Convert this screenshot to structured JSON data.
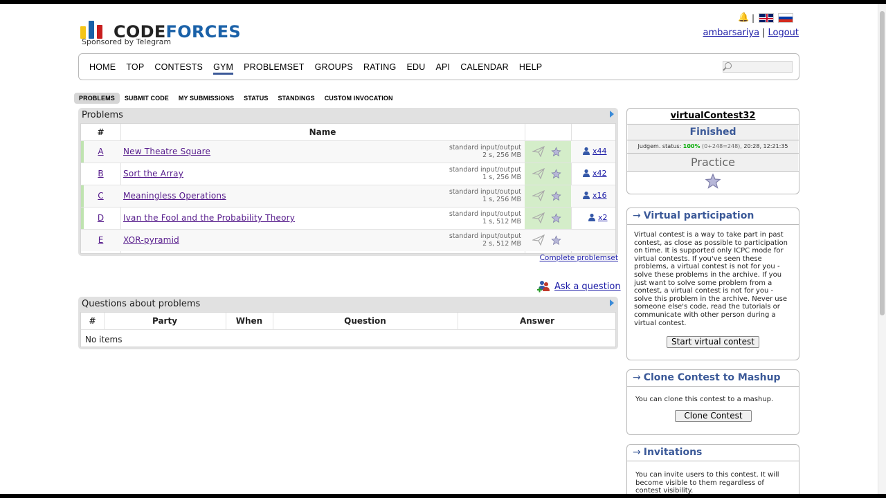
{
  "header": {
    "logo_main_1": "CODE",
    "logo_main_2": "FORCES",
    "logo_sub": "Sponsored by Telegram",
    "username": "ambarsariya",
    "logout": "Logout",
    "lang_sep": "|",
    "user_sep": "|"
  },
  "menu": {
    "items": [
      "HOME",
      "TOP",
      "CONTESTS",
      "GYM",
      "PROBLEMSET",
      "GROUPS",
      "RATING",
      "EDU",
      "API",
      "CALENDAR",
      "HELP"
    ],
    "active": "GYM"
  },
  "submenu": {
    "items": [
      "PROBLEMS",
      "SUBMIT CODE",
      "MY SUBMISSIONS",
      "STATUS",
      "STANDINGS",
      "CUSTOM INVOCATION"
    ],
    "active": "PROBLEMS"
  },
  "problems": {
    "caption": "Problems",
    "col_index": "#",
    "col_name": "Name",
    "rows": [
      {
        "index": "A",
        "name": "New Theatre Square",
        "io": "standard input/output",
        "limits": "2 s, 256 MB",
        "solved": true,
        "count": "x44"
      },
      {
        "index": "B",
        "name": "Sort the Array",
        "io": "standard input/output",
        "limits": "1 s, 256 MB",
        "solved": true,
        "count": "x42"
      },
      {
        "index": "C",
        "name": "Meaningless Operations",
        "io": "standard input/output",
        "limits": "1 s, 256 MB",
        "solved": true,
        "count": "x16"
      },
      {
        "index": "D",
        "name": "Ivan the Fool and the Probability Theory",
        "io": "standard input/output",
        "limits": "1 s, 512 MB",
        "solved": true,
        "count": "x2"
      },
      {
        "index": "E",
        "name": "XOR-pyramid",
        "io": "standard input/output",
        "limits": "2 s, 512 MB",
        "solved": false,
        "count": ""
      }
    ],
    "complete_link": "Complete problemset"
  },
  "ask_question": "Ask a question",
  "questions": {
    "caption": "Questions about problems",
    "columns": [
      "#",
      "Party",
      "When",
      "Question",
      "Answer"
    ],
    "empty": "No items"
  },
  "contest": {
    "name": "virtualContest32",
    "status": "Finished",
    "judge_prefix": "Judgem. status:",
    "judge_pct": "100%",
    "judge_detail": "(0+248=248),",
    "judge_time": "20:28, 12:21:35",
    "mode": "Practice"
  },
  "virtual": {
    "title": "Virtual participation",
    "text": "Virtual contest is a way to take part in past contest, as close as possible to participation on time. It is supported only ICPC mode for virtual contests. If you've seen these problems, a virtual contest is not for you - solve these problems in the archive. If you just want to solve some problem from a contest, a virtual contest is not for you - solve this problem in the archive. Never use someone else's code, read the tutorials or communicate with other person during a virtual contest.",
    "button": "Start virtual contest"
  },
  "clone": {
    "title": "Clone Contest to Mashup",
    "text": "You can clone this contest to a mashup.",
    "button": "Clone Contest"
  },
  "invitations": {
    "title": "Invitations",
    "text": "You can invite users to this contest. It will become visible to them regardless of contest visibility."
  },
  "colors": {
    "accent": "#3b5998",
    "link": "#1a1aa6",
    "visited": "#551a8b",
    "accepted": "#d4edc9",
    "logo_yellow": "#f5c518",
    "logo_blue": "#1a61a8",
    "logo_red": "#c81e1e"
  },
  "icons": {
    "bell": "bell-icon",
    "submit": "paper-plane-icon",
    "favourite": "star-icon",
    "solvers": "user-icon",
    "ask": "users-add-icon",
    "search": "search-icon"
  }
}
